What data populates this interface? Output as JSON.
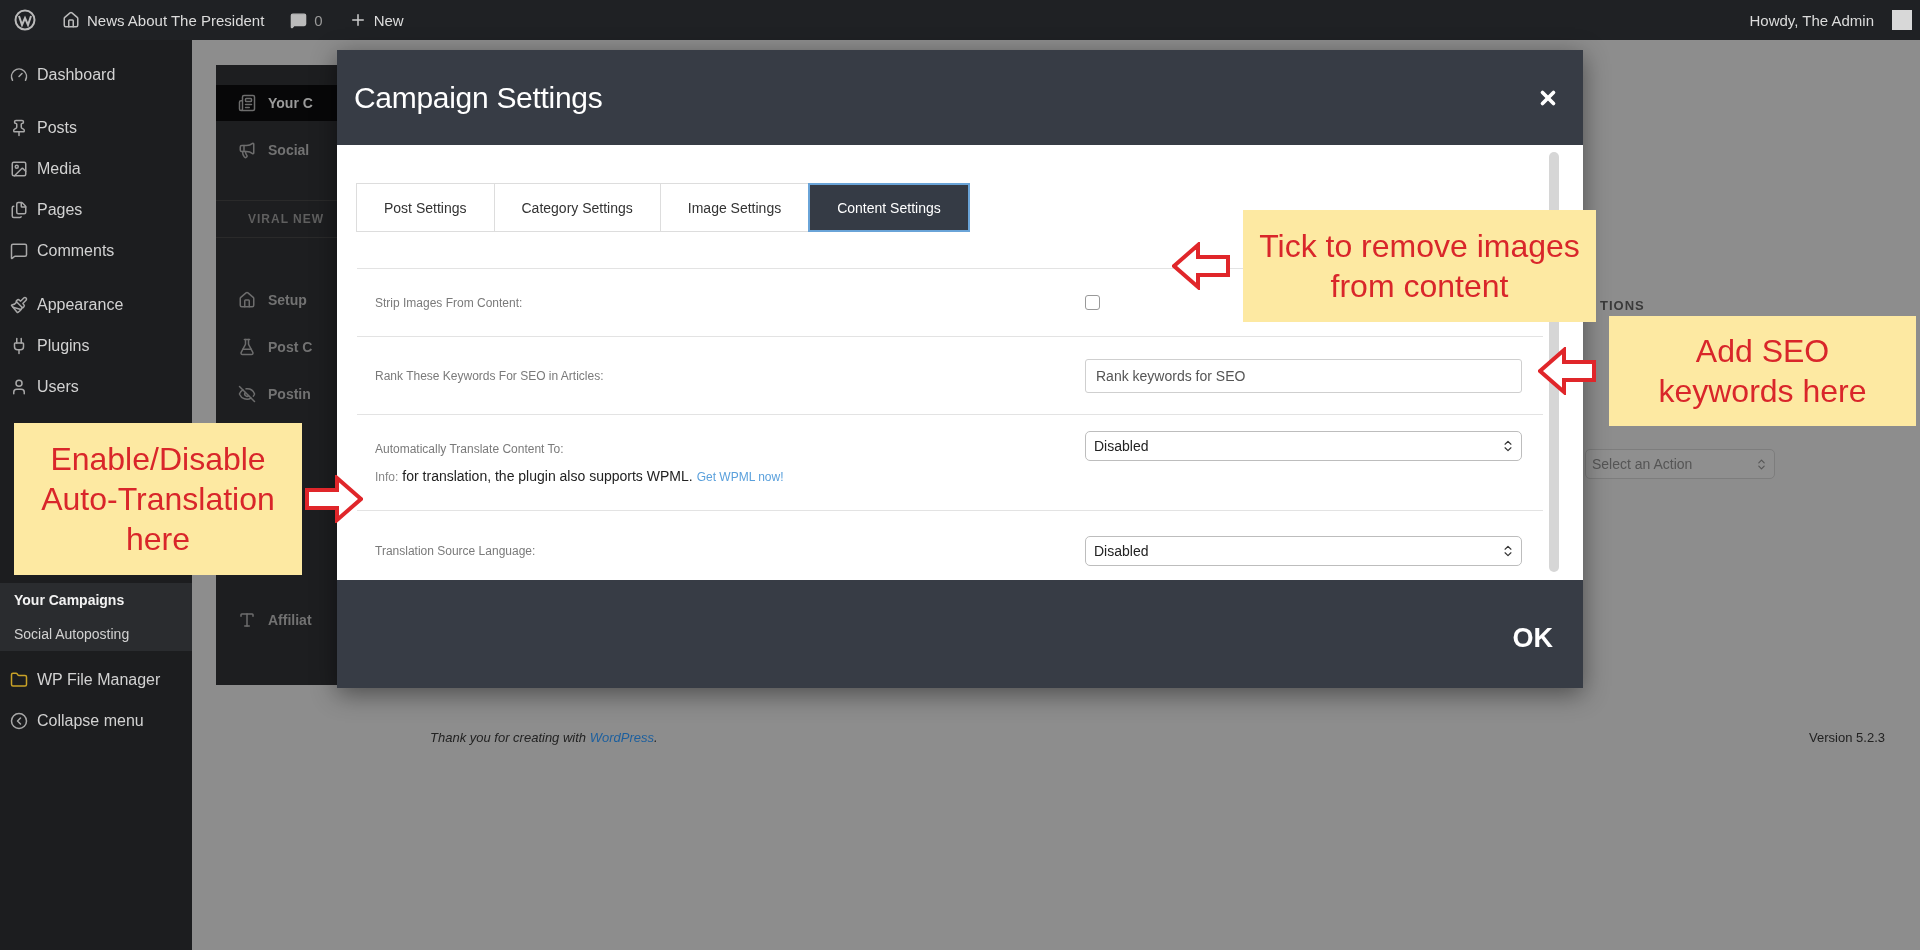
{
  "admin_bar": {
    "site_name": "News About The President",
    "comments_count": "0",
    "new_label": "New",
    "greeting": "Howdy, The Admin"
  },
  "sidebar": {
    "items": [
      {
        "label": "Dashboard",
        "kind": "menu",
        "selected": false
      },
      {
        "label": "Posts",
        "kind": "menu",
        "selected": false
      },
      {
        "label": "Media",
        "kind": "menu",
        "selected": false
      },
      {
        "label": "Pages",
        "kind": "menu",
        "selected": false
      },
      {
        "label": "Comments",
        "kind": "menu",
        "selected": false
      },
      {
        "label": "Appearance",
        "kind": "menu",
        "selected": false
      },
      {
        "label": "Plugins",
        "kind": "menu",
        "selected": false
      },
      {
        "label": "Users",
        "kind": "menu",
        "selected": false
      },
      {
        "label": "Your Campaigns",
        "kind": "submenu",
        "selected": true
      },
      {
        "label": "Social Autoposting",
        "kind": "submenu",
        "selected": false
      },
      {
        "label": "WP File Manager",
        "kind": "menu",
        "selected": false
      },
      {
        "label": "Collapse menu",
        "kind": "menu",
        "selected": false
      }
    ]
  },
  "plugin_menu": {
    "items": [
      {
        "label": "Your C",
        "kind": "item",
        "selected": true
      },
      {
        "label": "Social",
        "kind": "item",
        "selected": false
      },
      {
        "label": "VIRAL NEW",
        "kind": "heading"
      },
      {
        "label": "Setup",
        "kind": "item",
        "selected": false
      },
      {
        "label": "Post C",
        "kind": "item",
        "selected": false
      },
      {
        "label": "Postin",
        "kind": "item",
        "selected": false
      },
      {
        "label": "Affiliat",
        "kind": "item",
        "selected": false
      }
    ]
  },
  "background_panel": {
    "heading": "TIONS",
    "action_select": "Select an Action"
  },
  "dialog": {
    "title": "Campaign Settings",
    "tabs": [
      {
        "label": "Post Settings",
        "selected": false
      },
      {
        "label": "Category Settings",
        "selected": false
      },
      {
        "label": "Image Settings",
        "selected": false
      },
      {
        "label": "Content Settings",
        "selected": true
      }
    ],
    "fields": [
      {
        "kind": "checkbox",
        "label": "Strip Images From Content:",
        "checked": false
      },
      {
        "kind": "text",
        "label": "Rank These Keywords For SEO in Articles:",
        "placeholder": "Rank keywords for SEO"
      },
      {
        "kind": "select",
        "label": "Automatically Translate Content To:",
        "value": "Disabled",
        "info_label": "Info:",
        "info": "for translation, the plugin also supports WPML.",
        "info_link": "Get WPML now!"
      },
      {
        "kind": "select",
        "label": "Translation Source Language:",
        "value": "Disabled"
      }
    ],
    "ok_label": "OK"
  },
  "footer": {
    "thanks": "Thank you for creating with ",
    "link": "WordPress",
    "thanks_end": ".",
    "version": "Version 5.2.3"
  },
  "annotations": [
    {
      "text": "Tick to remove images from content",
      "kind": "arrow-left"
    },
    {
      "text": "Add SEO keywords here",
      "kind": "arrow-left"
    },
    {
      "text": "Enable/Disable Auto-Translation here",
      "kind": "arrow-right"
    }
  ]
}
